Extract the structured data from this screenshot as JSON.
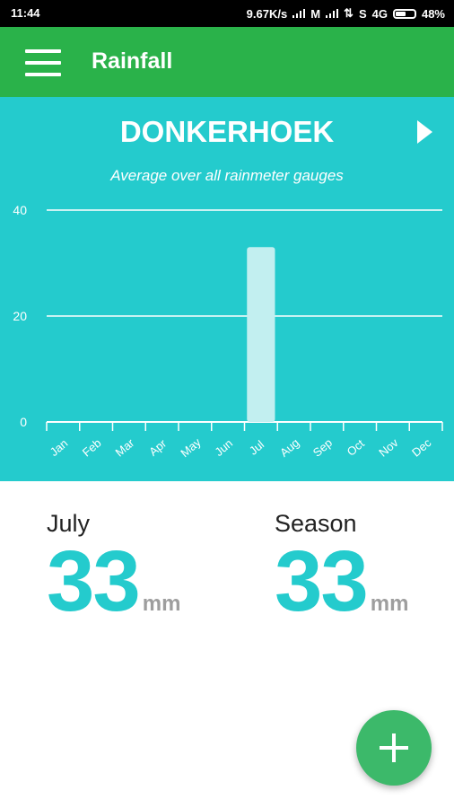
{
  "status": {
    "time": "11:44",
    "net_speed": "9.67K/s",
    "carrier": "M",
    "sim": "S",
    "network": "4G",
    "battery": "48%"
  },
  "app": {
    "title": "Rainfall"
  },
  "header": {
    "station": "DONKERHOEK",
    "subtitle": "Average over all rainmeter gauges"
  },
  "chart_data": {
    "type": "bar",
    "categories": [
      "Jan",
      "Feb",
      "Mar",
      "Apr",
      "May",
      "Jun",
      "Jul",
      "Aug",
      "Sep",
      "Oct",
      "Nov",
      "Dec"
    ],
    "values": [
      0,
      0,
      0,
      0,
      0,
      0,
      33,
      0,
      0,
      0,
      0,
      0
    ],
    "y_ticks": [
      0,
      20,
      40
    ],
    "ylim": [
      0,
      40
    ],
    "grid": true,
    "colors": {
      "bar": "#c2eff0",
      "grid": "#c8f2f2",
      "axis": "#ffffff"
    }
  },
  "summary": {
    "month": {
      "label": "July",
      "value": "33",
      "unit": "mm"
    },
    "season": {
      "label": "Season",
      "value": "33",
      "unit": "mm"
    }
  },
  "fab": {
    "icon": "plus-icon"
  },
  "colors": {
    "app_bar": "#2ab24a",
    "chart_bg": "#24cbcd",
    "value_text": "#24cbcd",
    "fab": "#3cb96a"
  }
}
